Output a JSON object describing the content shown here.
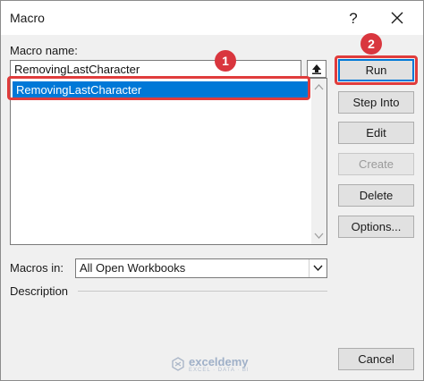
{
  "window": {
    "title": "Macro",
    "help_glyph": "?"
  },
  "macro_name": {
    "label": "Macro name:",
    "value": "RemovingLastCharacter"
  },
  "macro_list": {
    "items": [
      {
        "label": "RemovingLastCharacter",
        "selected": true
      }
    ]
  },
  "buttons": {
    "run": "Run",
    "step_into": "Step Into",
    "edit": "Edit",
    "create": "Create",
    "delete": "Delete",
    "options": "Options...",
    "cancel": "Cancel"
  },
  "macros_in": {
    "label": "Macros in:",
    "value": "All Open Workbooks"
  },
  "description": {
    "label": "Description"
  },
  "callouts": {
    "first": "1",
    "second": "2"
  },
  "watermark": {
    "name": "exceldemy",
    "tagline": "EXCEL · DATA · BI"
  },
  "colors": {
    "selection": "#0078d7",
    "callout": "#e03c3c"
  }
}
